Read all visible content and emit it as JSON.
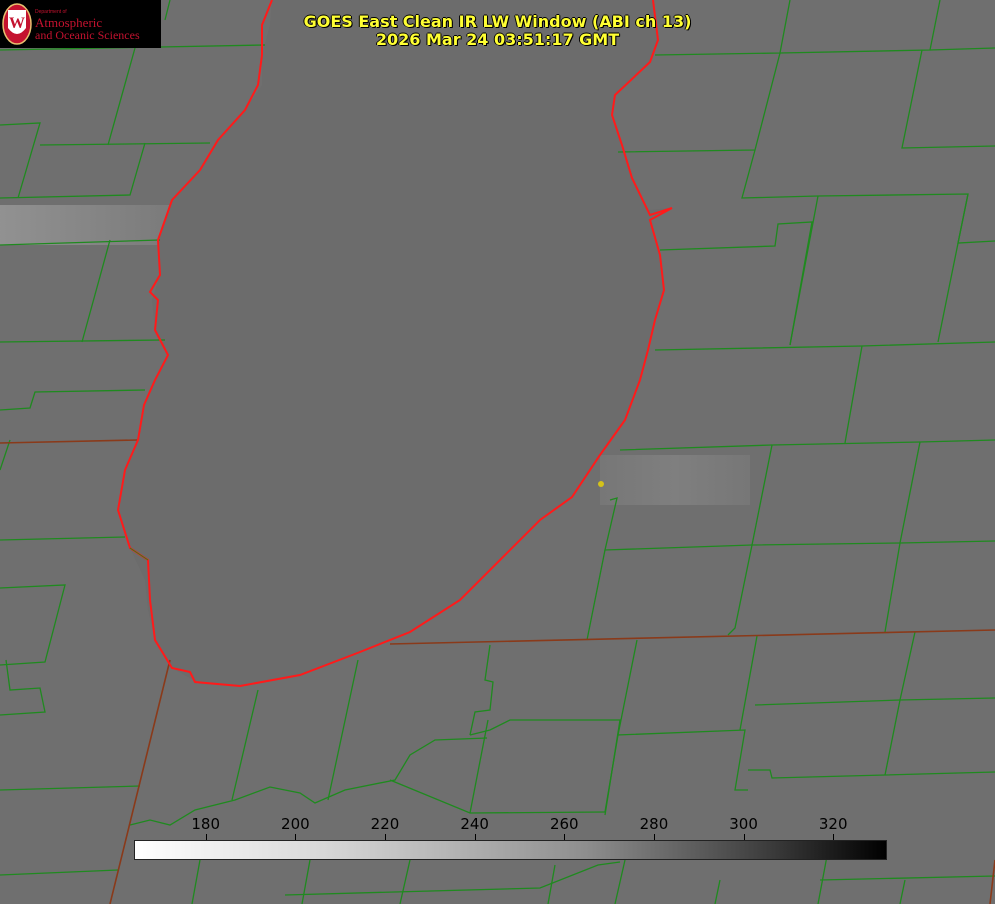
{
  "title": {
    "line1": "GOES East Clean IR LW Window (ABI ch 13)",
    "line2": "2026 Mar 24 03:51:17 GMT"
  },
  "logo": {
    "dept": "Department of",
    "line1": "Atmospheric",
    "line2": "and Oceanic Sciences",
    "seal_letter": "W"
  },
  "colorbar": {
    "ticks": [
      "180",
      "200",
      "220",
      "240",
      "260",
      "280",
      "300",
      "320"
    ],
    "range": [
      164,
      332
    ],
    "gradient": "white (cold) to black (warm)"
  },
  "colors": {
    "county_lines": "#1f8a1f",
    "state_lines": "#8a3a1a",
    "coastline": "#ff1a1a",
    "title_text": "#ffff33",
    "marker": "#d4c21a"
  }
}
